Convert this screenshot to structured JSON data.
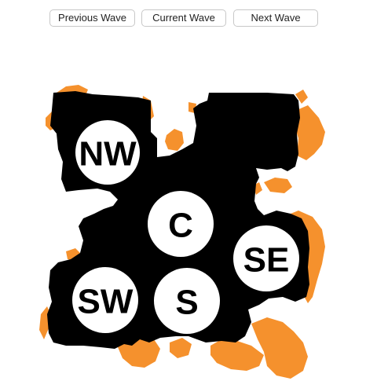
{
  "toolbar": {
    "previous_label": "Previous Wave",
    "current_label": "Current Wave",
    "next_label": "Next Wave"
  },
  "zones": {
    "nw": "NW",
    "c": "C",
    "se": "SE",
    "sw": "SW",
    "s": "S"
  },
  "colors": {
    "mask": "#000000",
    "spread": "#f5912d",
    "zone_fill": "#ffffff"
  }
}
